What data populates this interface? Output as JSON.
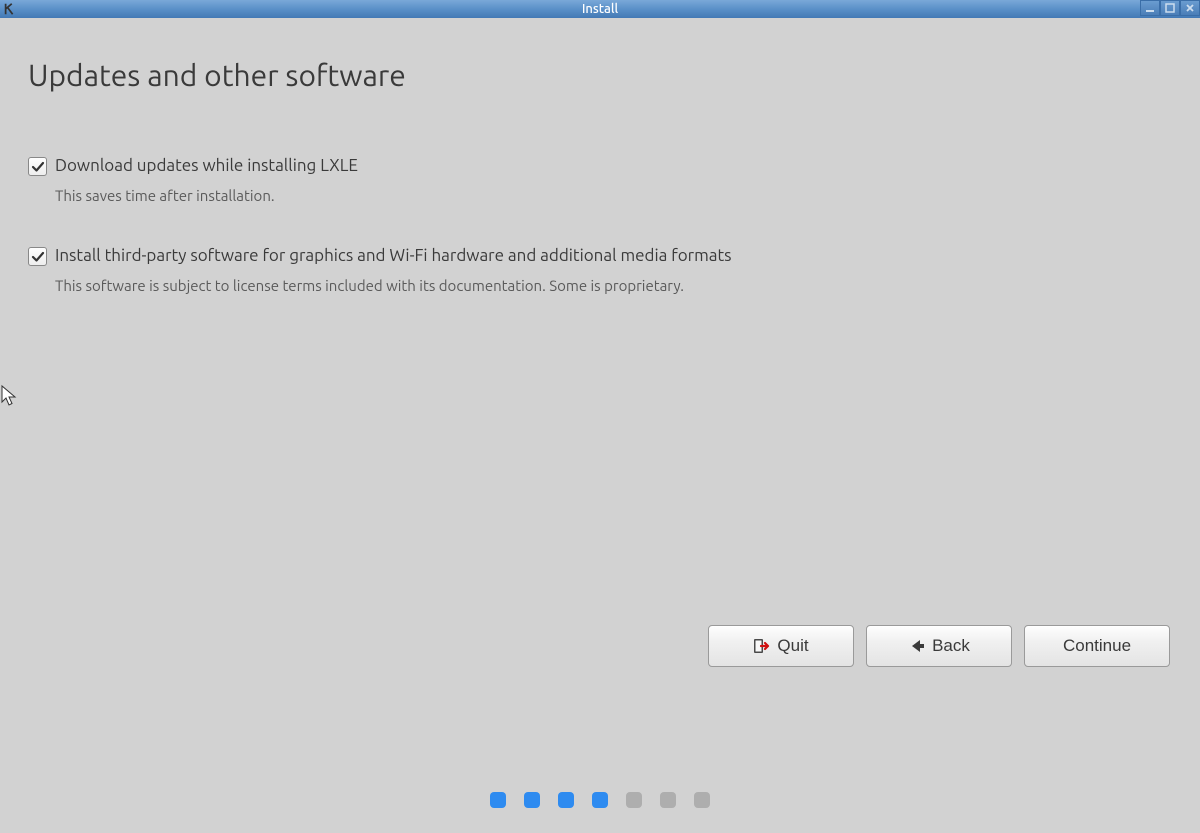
{
  "window": {
    "title": "Install"
  },
  "page": {
    "heading": "Updates and other software"
  },
  "options": [
    {
      "label": "Download updates while installing LXLE",
      "description": "This saves time after installation.",
      "checked": true
    },
    {
      "label": "Install third-party software for graphics and Wi-Fi hardware and additional media formats",
      "description": "This software is subject to license terms included with its documentation. Some is proprietary.",
      "checked": true
    }
  ],
  "buttons": {
    "quit": "Quit",
    "back": "Back",
    "continue": "Continue"
  },
  "progress": {
    "total": 7,
    "current": 4
  }
}
